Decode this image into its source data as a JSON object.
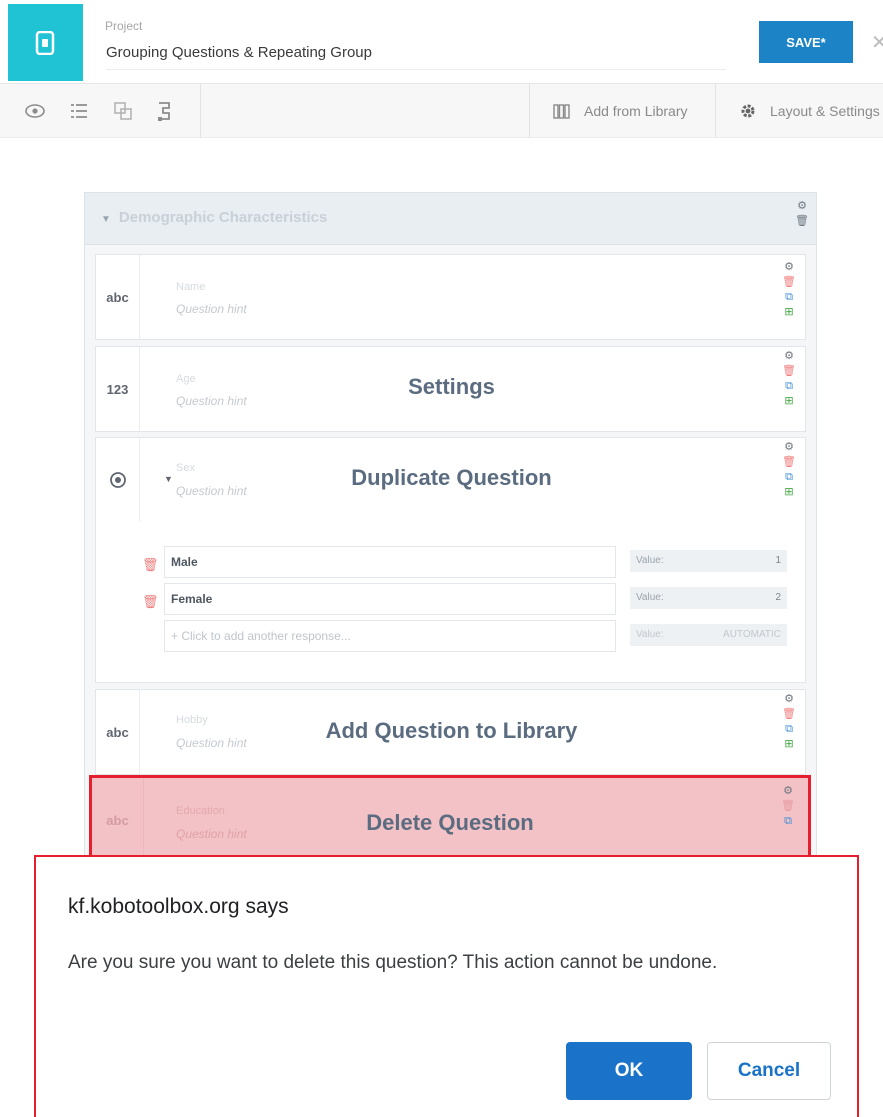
{
  "header": {
    "project_label": "Project",
    "project_name": "Grouping Questions & Repeating Group",
    "save_label": "SAVE*",
    "close_icon": "close-icon",
    "logo_icon": "phone-icon",
    "brand_color": "#1fc3d4",
    "save_color": "#1b83c6"
  },
  "toolbar": {
    "icons": [
      "eye-icon",
      "list-icon",
      "group-icon",
      "cascade-icon"
    ],
    "add_from_library": "Add from Library",
    "layout_settings": "Layout & Settings"
  },
  "group": {
    "title": "Demographic Characteristics"
  },
  "questions": [
    {
      "type": "abc",
      "label": "Name",
      "hint": "Question hint",
      "overlay": ""
    },
    {
      "type": "123",
      "label": "Age",
      "hint": "Question hint",
      "overlay": "Settings"
    },
    {
      "type": "radio",
      "label": "Sex",
      "hint": "Question hint",
      "overlay": "Duplicate Question"
    },
    {
      "type": "abc",
      "label": "Hobby",
      "hint": "Question hint",
      "overlay": "Add Question to Library"
    },
    {
      "type": "abc",
      "label": "Education",
      "hint": "Question hint",
      "overlay": "Delete Question"
    }
  ],
  "choices": [
    {
      "label": "Male",
      "value_label": "Value:",
      "value": "1"
    },
    {
      "label": "Female",
      "value_label": "Value:",
      "value": "2"
    }
  ],
  "add_choice": {
    "placeholder": "+ Click to add another response...",
    "value_label": "Value:",
    "value": "AUTOMATIC"
  },
  "dialog": {
    "title": "kf.kobotoolbox.org says",
    "message": "Are you sure you want to delete this question? This action cannot be undone.",
    "ok_label": "OK",
    "cancel_label": "Cancel"
  },
  "highlight_color": "#e51f2e"
}
